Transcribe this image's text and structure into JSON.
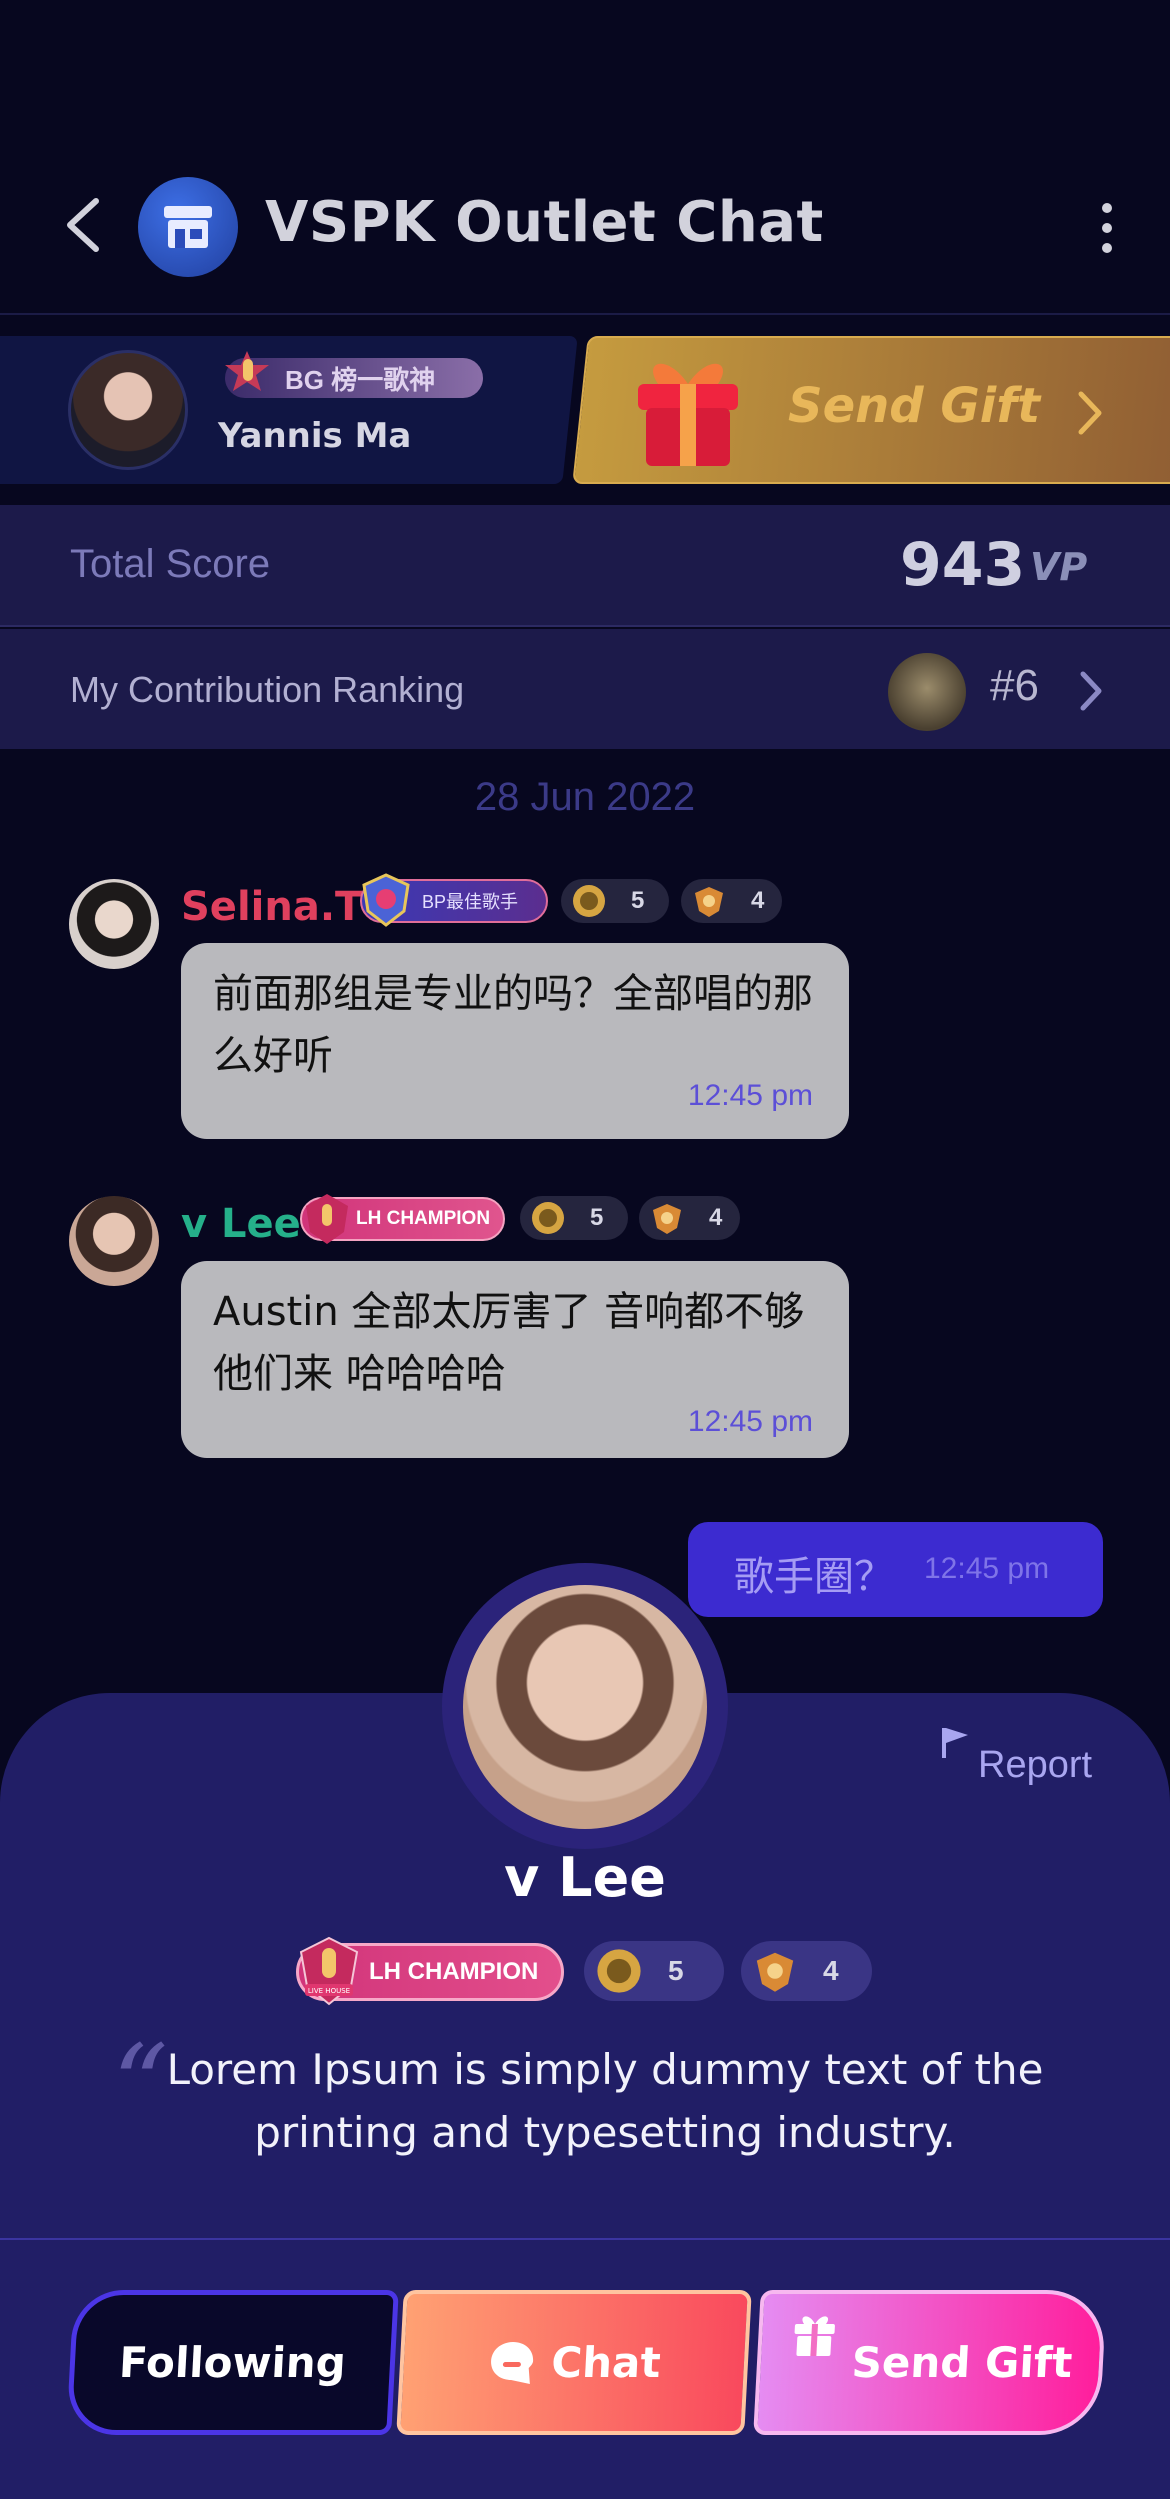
{
  "header": {
    "title": "VSPK Outlet Chat",
    "icons": [
      "back-icon",
      "store-icon",
      "more-vertical-icon"
    ]
  },
  "host": {
    "badge": "BG 榜一歌神",
    "name": "Yannis Ma",
    "send_gift": "Send Gift"
  },
  "score": {
    "label": "Total Score",
    "value": "943",
    "unit": "VP"
  },
  "ranking": {
    "label": "My Contribution Ranking",
    "value": "#6"
  },
  "date_separator": "28 Jun 2022",
  "messages": [
    {
      "name": "Selina.T",
      "name_color": "#e0405e",
      "title_badge": "BP最佳歌手",
      "level_1": "5",
      "level_2": "4",
      "text": "前面那组是专业的吗？全部唱的那么好听",
      "time": "12:45 pm"
    },
    {
      "name": "v Lee",
      "name_color": "#25b08a",
      "title_badge": "LH CHAMPION",
      "level_1": "5",
      "level_2": "4",
      "text": "Austin 全部太厉害了 音响都不够他们来 哈哈哈哈",
      "time": "12:45 pm"
    }
  ],
  "outgoing": {
    "text": "歌手圈？",
    "time": "12:45 pm"
  },
  "profile": {
    "report": "Report",
    "name": "v Lee",
    "title_badge": "LH CHAMPION",
    "badge_small": "LIVE HOUSE",
    "level_1": "5",
    "level_2": "4",
    "bio": "Lorem Ipsum is simply dummy text of the printing and typesetting industry."
  },
  "actions": {
    "following": "Following",
    "chat": "Chat",
    "send_gift": "Send Gift"
  },
  "colors": {
    "background": "#07071f",
    "panel": "#1c1a4a",
    "sheet": "#211e66",
    "accent": "#3c2bd0"
  }
}
